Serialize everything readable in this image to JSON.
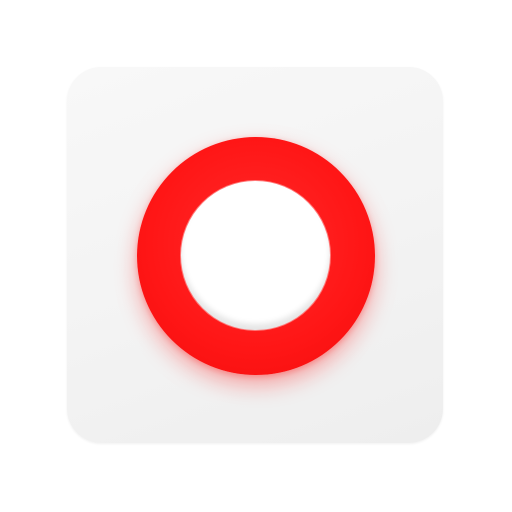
{
  "icon": {
    "name": "record-ring-app-icon",
    "background_color": "#f4f4f4",
    "ring_color": "#ff1a1a",
    "center_color": "#ffffff"
  }
}
